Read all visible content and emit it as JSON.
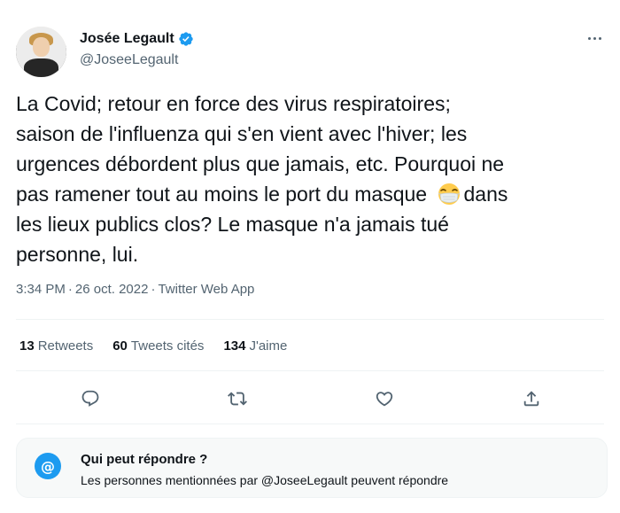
{
  "author": {
    "display_name": "Josée Legault",
    "handle": "@JoseeLegault",
    "verified": true
  },
  "tweet": {
    "text_before_emoji": "La Covid; retour en force des virus respiratoires;\nsaison de l'influenza qui s'en vient avec l'hiver; les\nurgences débordent plus que jamais, etc. Pourquoi ne\npas ramener tout au moins le port du masque ",
    "emoji": "face-with-medical-mask-emoji",
    "text_after_emoji": "dans\nles lieux publics clos? Le masque n'a jamais tué\npersonne, lui."
  },
  "meta": {
    "time": "3:34 PM",
    "separator": "·",
    "date": "26 oct. 2022",
    "source": "Twitter Web App"
  },
  "stats": {
    "retweets_count": "13",
    "retweets_label": "Retweets",
    "quotes_count": "60",
    "quotes_label": "Tweets cités",
    "likes_count": "134",
    "likes_label": "J'aime"
  },
  "actions": {
    "reply_icon": "reply-icon",
    "retweet_icon": "retweet-icon",
    "like_icon": "heart-icon",
    "share_icon": "share-icon"
  },
  "reply_settings": {
    "icon": "at-icon",
    "at_symbol": "@",
    "title": "Qui peut répondre ?",
    "description": "Les personnes mentionnées par @JoseeLegault peuvent répondre"
  },
  "colors": {
    "accent": "#1d9bf0",
    "text": "#0f1419",
    "muted": "#536471"
  }
}
